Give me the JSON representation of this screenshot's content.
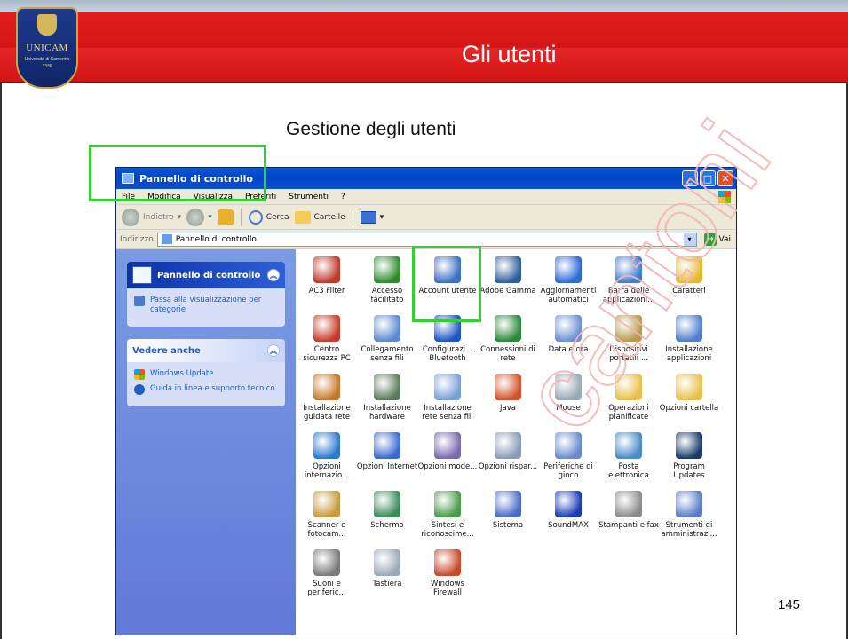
{
  "slide": {
    "title": "Gli utenti",
    "subtitle": "Gestione degli utenti",
    "page_number": "145",
    "watermark": "cantoni",
    "logo": {
      "name": "UNICAM",
      "sub": "Università di Camerino",
      "year": "1336"
    }
  },
  "window": {
    "title": "Pannello di controllo",
    "menu": [
      "File",
      "Modifica",
      "Visualizza",
      "Preferiti",
      "Strumenti",
      "?"
    ],
    "toolbar": {
      "back": "Indietro",
      "search": "Cerca",
      "folders": "Cartelle"
    },
    "address": {
      "label": "Indirizzo",
      "value": "Pannello di controllo",
      "go": "Vai"
    },
    "taskpane": {
      "control_panel": {
        "title": "Pannello di controllo",
        "link": "Passa alla visualizzazione per categorie"
      },
      "see_also": {
        "title": "Vedere anche",
        "links": [
          "Windows Update",
          "Guida in linea e supporto tecnico"
        ]
      }
    },
    "icons": [
      {
        "label": "AC3 Filter",
        "icon": "ac3-filter-icon",
        "color": "#c0392b"
      },
      {
        "label": "Accesso facilitato",
        "icon": "accessibility-icon",
        "color": "#2e8b2e"
      },
      {
        "label": "Account utente",
        "icon": "user-accounts-icon",
        "color": "#3d6fc7"
      },
      {
        "label": "Adobe Gamma",
        "icon": "adobe-gamma-icon",
        "color": "#2e5e9e"
      },
      {
        "label": "Aggiornamenti automatici",
        "icon": "windows-update-icon",
        "color": "#2d6ad6"
      },
      {
        "label": "Barra delle applicazioni...",
        "icon": "taskbar-icon",
        "color": "#3f7bd8"
      },
      {
        "label": "Caratteri",
        "icon": "fonts-icon",
        "color": "#e6b832"
      },
      {
        "label": "Centro sicurezza PC",
        "icon": "security-center-icon",
        "color": "#c83a2a"
      },
      {
        "label": "Collegamento senza fili",
        "icon": "wireless-link-icon",
        "color": "#5a8ad0"
      },
      {
        "label": "Configurazi... Bluetooth",
        "icon": "bluetooth-icon",
        "color": "#1e56c8"
      },
      {
        "label": "Connessioni di rete",
        "icon": "network-connections-icon",
        "color": "#2b8a3c"
      },
      {
        "label": "Data e ora",
        "icon": "date-time-icon",
        "color": "#6a8fd5"
      },
      {
        "label": "Dispositivi portatili ...",
        "icon": "portable-devices-icon",
        "color": "#b89a50"
      },
      {
        "label": "Installazione applicazioni",
        "icon": "add-remove-programs-icon",
        "color": "#4f7fcc"
      },
      {
        "label": "Installazione guidata rete",
        "icon": "network-setup-icon",
        "color": "#c67a2a"
      },
      {
        "label": "Installazione hardware",
        "icon": "add-hardware-icon",
        "color": "#5c7a5c"
      },
      {
        "label": "Installazione rete senza fili",
        "icon": "wireless-setup-icon",
        "color": "#7aa0d8"
      },
      {
        "label": "Java",
        "icon": "java-icon",
        "color": "#d2532a"
      },
      {
        "label": "Mouse",
        "icon": "mouse-icon",
        "color": "#9aa8b8"
      },
      {
        "label": "Operazioni pianificate",
        "icon": "scheduled-tasks-icon",
        "color": "#e8c04a"
      },
      {
        "label": "Opzioni cartella",
        "icon": "folder-options-icon",
        "color": "#e8c04a"
      },
      {
        "label": "Opzioni internazio...",
        "icon": "regional-options-icon",
        "color": "#2b7ad0"
      },
      {
        "label": "Opzioni Internet",
        "icon": "internet-options-icon",
        "color": "#3a6ad0"
      },
      {
        "label": "Opzioni mode...",
        "icon": "modem-options-icon",
        "color": "#7a6ab0"
      },
      {
        "label": "Opzioni rispar...",
        "icon": "power-options-icon",
        "color": "#8a9ab8"
      },
      {
        "label": "Periferiche di gioco",
        "icon": "game-controllers-icon",
        "color": "#6a8ad0"
      },
      {
        "label": "Posta elettronica",
        "icon": "mail-icon",
        "color": "#4a8ac8"
      },
      {
        "label": "Program Updates",
        "icon": "program-updates-icon",
        "color": "#1a3a6a"
      },
      {
        "label": "Scanner e fotocam...",
        "icon": "scanners-cameras-icon",
        "color": "#c89a3a"
      },
      {
        "label": "Schermo",
        "icon": "display-icon",
        "color": "#3a8a5a"
      },
      {
        "label": "Sintesi e riconoscime...",
        "icon": "speech-icon",
        "color": "#4a9a4a"
      },
      {
        "label": "Sistema",
        "icon": "system-icon",
        "color": "#4a6ac8"
      },
      {
        "label": "SoundMAX",
        "icon": "soundmax-icon",
        "color": "#1a3ab8"
      },
      {
        "label": "Stampanti e fax",
        "icon": "printers-fax-icon",
        "color": "#8a8a8a"
      },
      {
        "label": "Strumenti di amministrazi...",
        "icon": "admin-tools-icon",
        "color": "#5a7ac8"
      },
      {
        "label": "Suoni e periferic...",
        "icon": "sounds-icon",
        "color": "#7a7a7a"
      },
      {
        "label": "Tastiera",
        "icon": "keyboard-icon",
        "color": "#9aa8b8"
      },
      {
        "label": "Windows Firewall",
        "icon": "firewall-icon",
        "color": "#c84a2a"
      }
    ]
  }
}
